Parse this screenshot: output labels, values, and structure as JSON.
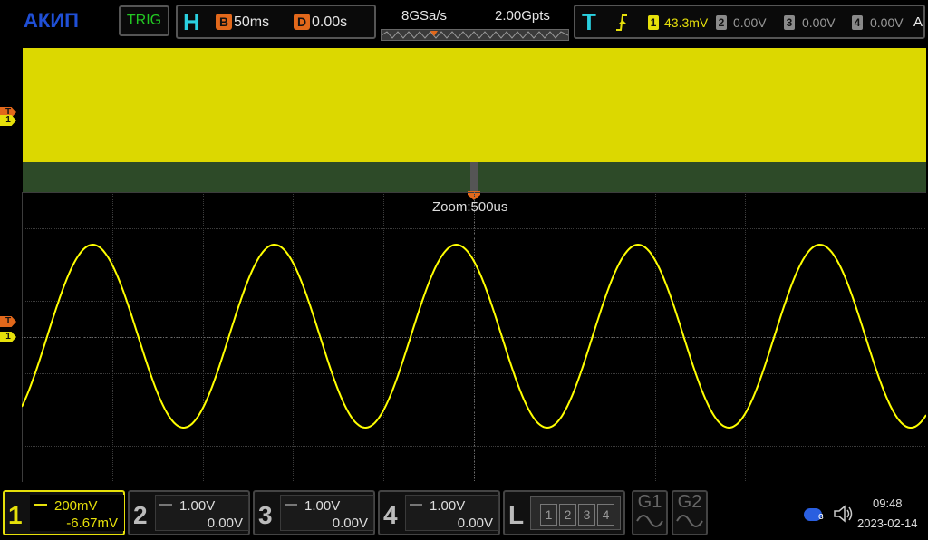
{
  "brand": {
    "logo": "АКИП"
  },
  "trigger_button": {
    "label": "TRIG"
  },
  "horizontal": {
    "label": "H",
    "base_badge": "B",
    "base_value": "50ms",
    "delay_badge": "D",
    "delay_value": "0.00s"
  },
  "acquisition": {
    "sample_rate": "8GSa/s",
    "memory_depth": "2.00Gpts"
  },
  "trigger": {
    "label": "T",
    "slope_icon": "rising-edge-icon",
    "channels": [
      {
        "badge": "1",
        "value": "43.3mV",
        "color": "#e6e00a"
      },
      {
        "badge": "2",
        "value": "0.00V",
        "color": "#9a9a9a"
      },
      {
        "badge": "3",
        "value": "0.00V",
        "color": "#9a9a9a"
      },
      {
        "badge": "4",
        "value": "0.00V",
        "color": "#9a9a9a"
      }
    ],
    "mode": "A"
  },
  "screen": {
    "zoom_label": "Zoom:500us",
    "trigger_marker": "T",
    "channel_marker": "1",
    "trace_color": "#ffff00",
    "overview_color": "#dcd800"
  },
  "channels": [
    {
      "num": "1",
      "scale": "200mV",
      "offset": "-6.67mV",
      "color": "#e6e00a",
      "active": true
    },
    {
      "num": "2",
      "scale": "1.00V",
      "offset": "0.00V",
      "color": "#bbbbbb",
      "active": false
    },
    {
      "num": "3",
      "scale": "1.00V",
      "offset": "0.00V",
      "color": "#bbbbbb",
      "active": false
    },
    {
      "num": "4",
      "scale": "1.00V",
      "offset": "0.00V",
      "color": "#bbbbbb",
      "active": false
    }
  ],
  "logic": {
    "label": "L",
    "slots": [
      "1",
      "2",
      "3",
      "4"
    ]
  },
  "generators": [
    {
      "label": "G1"
    },
    {
      "label": "G2"
    }
  ],
  "status": {
    "time": "09:48",
    "date": "2023-02-14",
    "usb_icon": "usb-icon",
    "speaker_icon": "speaker-icon"
  }
}
